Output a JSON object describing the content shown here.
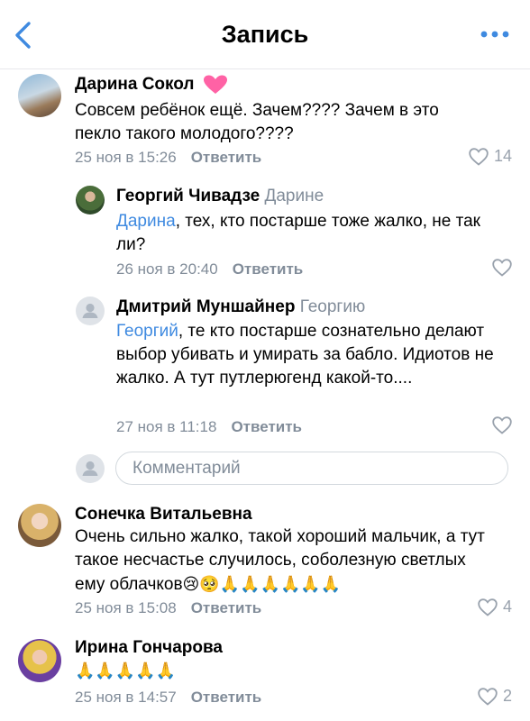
{
  "header": {
    "title": "Запись"
  },
  "comments": [
    {
      "author": "Дарина Сокол",
      "text": "Совсем ребёнок ещё. Зачем???? Зачем в это пекло такого молодого????",
      "date": "25 ноя в 15:26",
      "reply": "Ответить",
      "likes": "14"
    },
    {
      "author": "Георгий Чивадзе",
      "reply_to": "Дарине",
      "mention": "Дарина",
      "text": ", тех, кто постарше тоже жалко, не так ли?",
      "date": "26 ноя в 20:40",
      "reply": "Ответить"
    },
    {
      "author": "Дмитрий Муншайнер",
      "reply_to": "Георгию",
      "mention": "Георгий",
      "text": ", те кто постарше сознательно делают выбор убивать и умирать за бабло. Идиотов не жалко. А тут путлерюгенд какой-то....",
      "date": "27 ноя в 11:18",
      "reply": "Ответить"
    },
    {
      "author": "Сонечка Витальевна",
      "text": "Очень сильно жалко, такой хороший мальчик, а тут такое несчастье случилось, соболезную светлых ему облачков",
      "emoji": "😢🥺🙏🙏🙏🙏🙏🙏",
      "date": "25 ноя в 15:08",
      "reply": "Ответить",
      "likes": "4"
    },
    {
      "author": "Ирина Гончарова",
      "emoji": "🙏🙏🙏🙏🙏",
      "date": "25 ноя в 14:57",
      "reply": "Ответить",
      "likes": "2"
    }
  ],
  "comment_input": {
    "placeholder": "Комментарий"
  },
  "colors": {
    "accent": "#3f8ae0",
    "secondary": "#818c99",
    "heart": "#ff5c8a"
  },
  "icons": [
    "back-chevron-icon",
    "more-dots-icon",
    "heart-icon",
    "default-avatar-icon"
  ]
}
